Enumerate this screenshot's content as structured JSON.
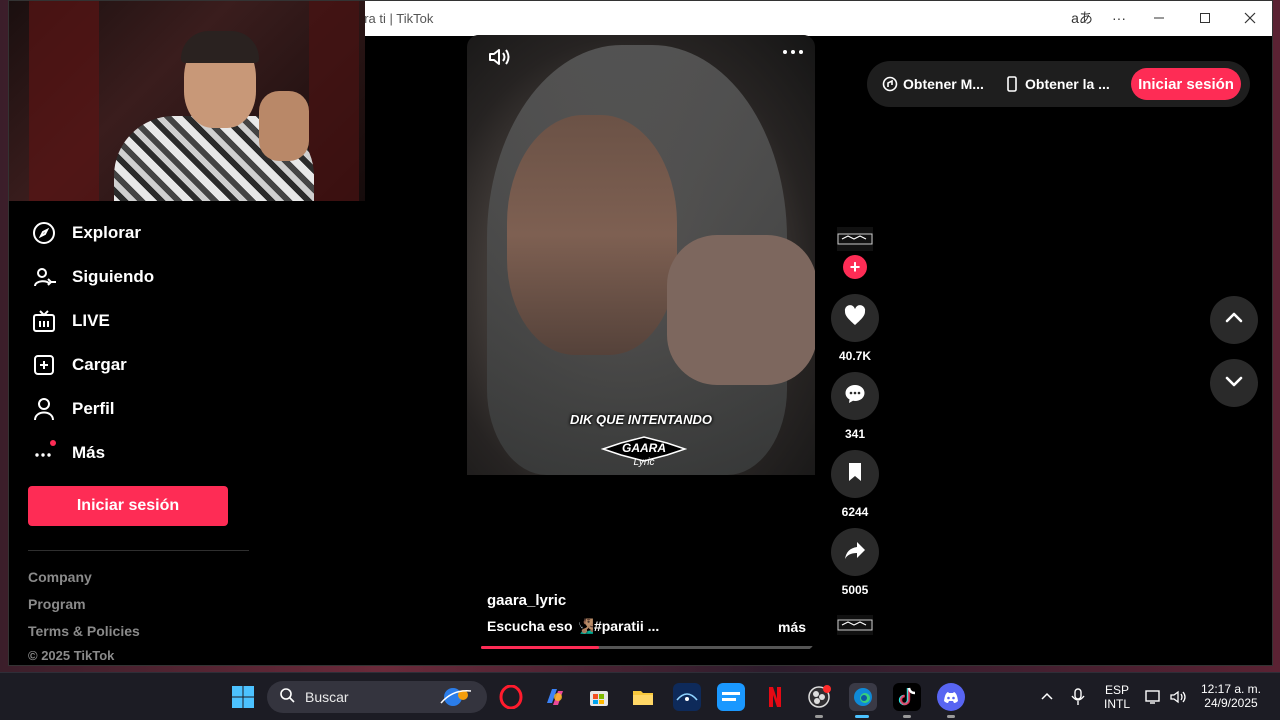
{
  "window": {
    "title": "ara ti | TikTok",
    "read_aloud_icon": "aあ",
    "more": "···"
  },
  "sidebar": {
    "items": [
      {
        "label": "Explorar",
        "icon": "compass-icon"
      },
      {
        "label": "Siguiendo",
        "icon": "following-icon"
      },
      {
        "label": "LIVE",
        "icon": "live-tv-icon"
      },
      {
        "label": "Cargar",
        "icon": "upload-plus-icon"
      },
      {
        "label": "Perfil",
        "icon": "profile-icon"
      },
      {
        "label": "Más",
        "icon": "more-dots-icon"
      }
    ],
    "login_label": "Iniciar sesión",
    "footer": {
      "company": "Company",
      "program": "Program",
      "terms": "Terms & Policies",
      "copyright": "© 2025 TikTok"
    }
  },
  "topbar": {
    "get_coins": "Obtener M...",
    "get_app": "Obtener la ...",
    "login": "Iniciar sesión"
  },
  "video": {
    "caption": "DIK QUE INTENTANDO",
    "logo_line1": "GAARA",
    "logo_line2": "Lyric",
    "username": "gaara_lyric",
    "description": "Escucha eso 🧏🏽‍♂️#paratii  ...",
    "more": "más",
    "progress": 0.35
  },
  "actions": {
    "likes": "40.7K",
    "comments": "341",
    "saves": "6244",
    "shares": "5005",
    "follow": "+"
  },
  "taskbar": {
    "search_placeholder": "Buscar",
    "lang_top": "ESP",
    "lang_bottom": "INTL",
    "time": "12:17 a. m.",
    "date": "24/9/2025"
  },
  "colors": {
    "accent": "#fe2c55",
    "background": "#000000",
    "button_bg": "#2a2a2a"
  }
}
